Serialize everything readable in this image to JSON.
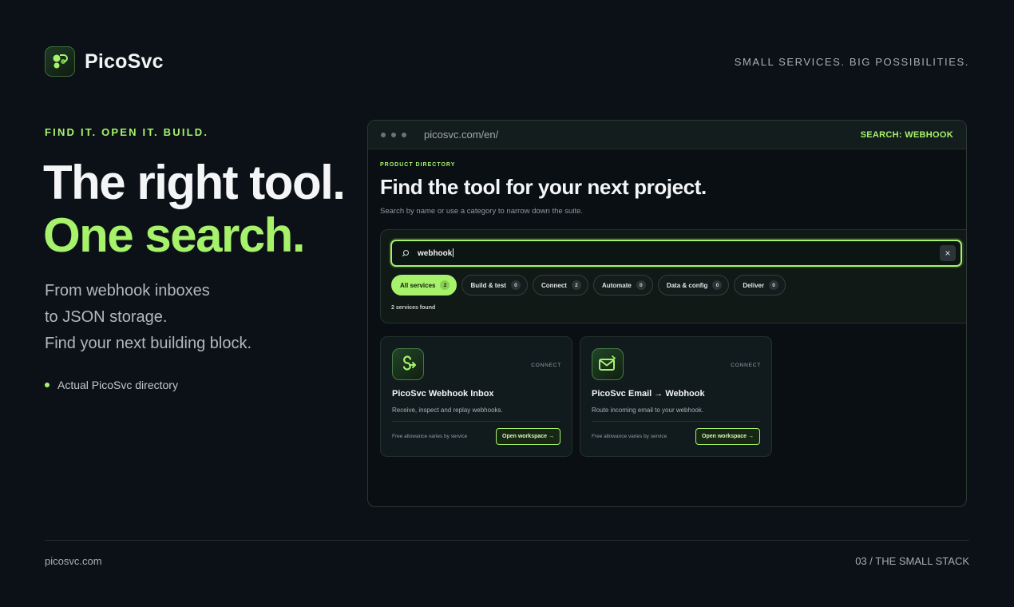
{
  "brand": {
    "name": "PicoSvc",
    "tagline": "SMALL SERVICES. BIG POSSIBILITIES.",
    "accent": "#a6f26b",
    "background": "#0c1117"
  },
  "hero": {
    "eyebrow": "FIND IT. OPEN IT. BUILD.",
    "line1": "The right tool.",
    "line2": "One search.",
    "subtitle": [
      "From webhook inboxes",
      "to JSON storage.",
      "Find your next building block."
    ],
    "bullet": "Actual PicoSvc directory"
  },
  "browser": {
    "url": "picosvc.com/en/",
    "search_tag": "SEARCH: WEBHOOK",
    "directory": {
      "label": "PRODUCT DIRECTORY",
      "title": "Find the tool for your next project.",
      "description": "Search by name or use a category to narrow down the suite.",
      "search_value": "webhook",
      "clear_icon": "×",
      "filters": [
        {
          "label": "All services",
          "count": "2",
          "active": true
        },
        {
          "label": "Build & test",
          "count": "0"
        },
        {
          "label": "Connect",
          "count": "2"
        },
        {
          "label": "Automate",
          "count": "0"
        },
        {
          "label": "Data & config",
          "count": "0"
        },
        {
          "label": "Deliver",
          "count": "0"
        }
      ],
      "results_text": "2 services found",
      "cards": [
        {
          "icon": "webhook-icon",
          "category": "CONNECT",
          "title": "PicoSvc Webhook Inbox",
          "description": "Receive, inspect and replay webhooks.",
          "footnote": "Free allowance varies by service",
          "button": "Open workspace →"
        },
        {
          "icon": "email-icon",
          "category": "CONNECT",
          "title": "PicoSvc Email → Webhook",
          "description": "Route incoming email to your webhook.",
          "footnote": "Free allowance varies by service",
          "button": "Open workspace →"
        }
      ]
    }
  },
  "footer": {
    "left": "picosvc.com",
    "right": "03 / THE SMALL STACK"
  }
}
